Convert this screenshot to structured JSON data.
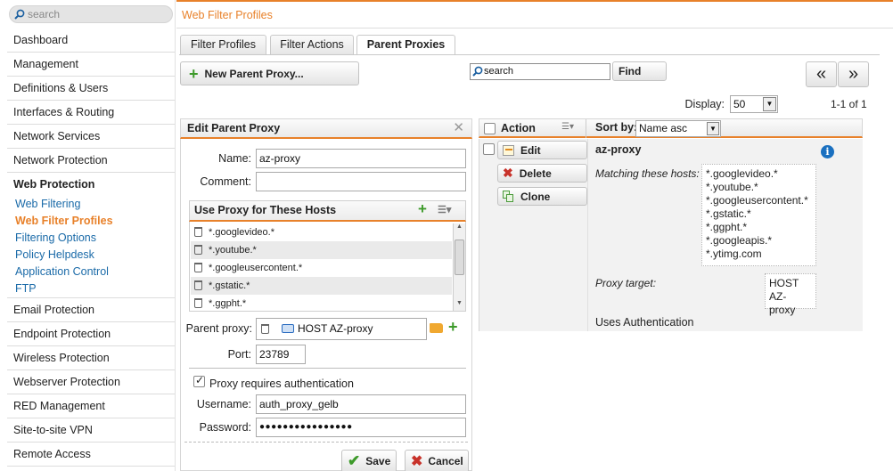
{
  "sidebar": {
    "search_placeholder": "search",
    "items": [
      {
        "label": "Dashboard"
      },
      {
        "label": "Management"
      },
      {
        "label": "Definitions & Users"
      },
      {
        "label": "Interfaces & Routing"
      },
      {
        "label": "Network Services"
      },
      {
        "label": "Network Protection"
      },
      {
        "label": "Web Protection"
      },
      {
        "label": "Email Protection"
      },
      {
        "label": "Endpoint Protection"
      },
      {
        "label": "Wireless Protection"
      },
      {
        "label": "Webserver Protection"
      },
      {
        "label": "RED Management"
      },
      {
        "label": "Site-to-site VPN"
      },
      {
        "label": "Remote Access"
      }
    ],
    "web_protection_subitems": [
      {
        "label": "Web Filtering"
      },
      {
        "label": "Web Filter Profiles"
      },
      {
        "label": "Filtering Options"
      },
      {
        "label": "Policy Helpdesk"
      },
      {
        "label": "Application Control"
      },
      {
        "label": "FTP"
      }
    ]
  },
  "header": {
    "title": "Web Filter Profiles"
  },
  "tabs": [
    {
      "label": "Filter Profiles"
    },
    {
      "label": "Filter Actions"
    },
    {
      "label": "Parent Proxies"
    }
  ],
  "toolbar": {
    "new_button": "New Parent Proxy...",
    "search_placeholder": "search",
    "find_button": "Find",
    "prev_symbol": "«",
    "next_symbol": "»",
    "display_label": "Display:",
    "display_value": "50",
    "pagination": "1-1 of 1"
  },
  "edit_panel": {
    "title": "Edit Parent Proxy",
    "name_label": "Name:",
    "name_value": "az-proxy",
    "comment_label": "Comment:",
    "comment_value": "",
    "hosts_title": "Use Proxy for These Hosts",
    "hosts": [
      "*.googlevideo.*",
      "*.youtube.*",
      "*.googleusercontent.*",
      "*.gstatic.*",
      "*.ggpht.*"
    ],
    "parent_proxy_label": "Parent proxy:",
    "parent_proxy_value": "HOST AZ-proxy",
    "port_label": "Port:",
    "port_value": "23789",
    "auth_label": "Proxy requires authentication",
    "auth_checked": true,
    "username_label": "Username:",
    "username_value": "auth_proxy_gelb",
    "password_label": "Password:",
    "password_value": "●●●●●●●●●●●●●●●●",
    "save_button": "Save",
    "cancel_button": "Cancel"
  },
  "table": {
    "action_header": "Action",
    "sort_label": "Sort by:",
    "sort_value": "Name asc",
    "row": {
      "name": "az-proxy",
      "edit_button": "Edit",
      "delete_button": "Delete",
      "clone_button": "Clone",
      "matching_label": "Matching these hosts:",
      "matching_hosts": [
        "*.googlevideo.*",
        "*.youtube.*",
        "*.googleusercontent.*",
        "*.gstatic.*",
        "*.ggpht.*",
        "*.googleapis.*",
        "*.ytimg.com"
      ],
      "proxy_target_label": "Proxy target:",
      "proxy_target_lines": [
        "HOST",
        "AZ-proxy"
      ],
      "uses_auth": "Uses Authentication"
    }
  },
  "colors": {
    "accent": "#e8812a",
    "link": "#1a6aa8",
    "add_green": "#3d9a2a",
    "delete_red": "#c8322a",
    "info_blue": "#1a70c0"
  }
}
